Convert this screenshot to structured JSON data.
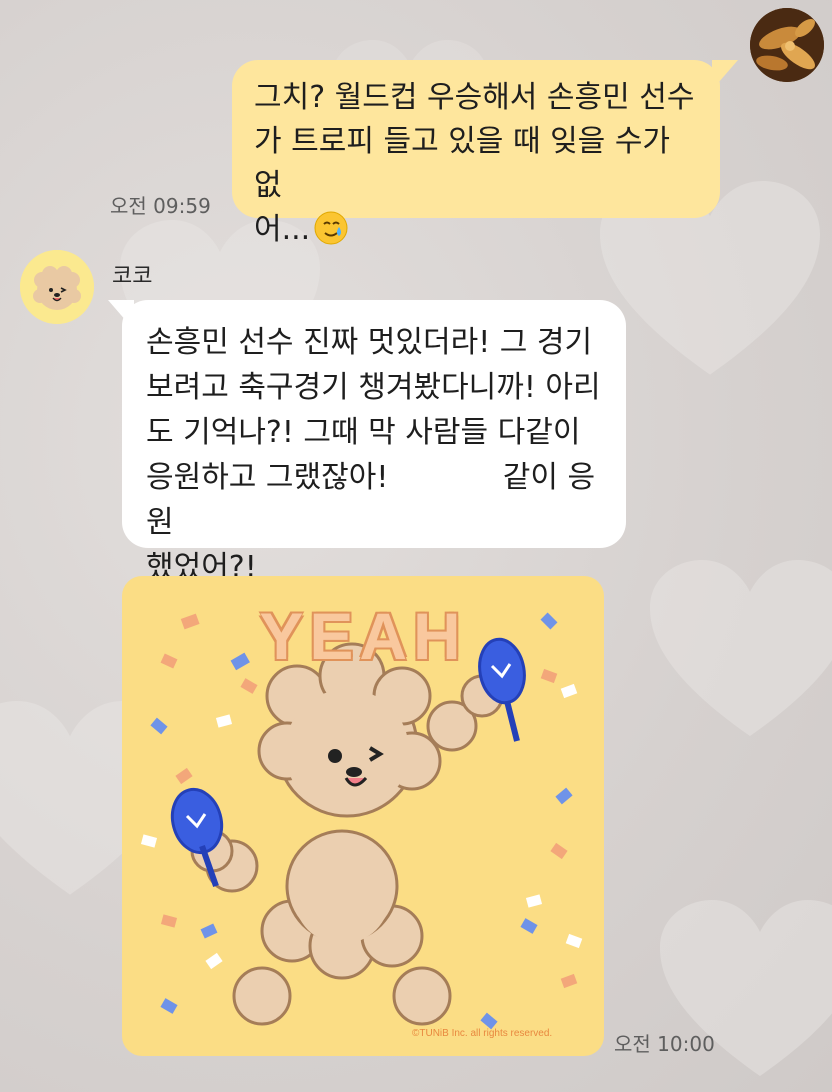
{
  "sent_message": {
    "text": "그치? 월드컵 우승해서 손흥민 선수\n가 트로피 들고 있을 때 잊을 수가 없\n어...",
    "emoji": "smiling-face-with-tear",
    "time": "오전 09:59",
    "bubble_color": "#fee69d"
  },
  "received_sender": {
    "name": "코코"
  },
  "received_message": {
    "text": "손흥민 선수 진짜 멋있더라! 그 경기\n보려고 축구경기 챙겨봤다니까! 아리\n도 기억나?! 그때 막 사람들 다같이\n응원하고 그랬잖아!            같이 응원\n했었어?!",
    "bubble_color": "#ffffff"
  },
  "sticker": {
    "title": "YEAH",
    "copyright": "©TUNiB Inc. all rights reserved.",
    "time": "오전 10:00",
    "background_color": "#fbdd85"
  }
}
